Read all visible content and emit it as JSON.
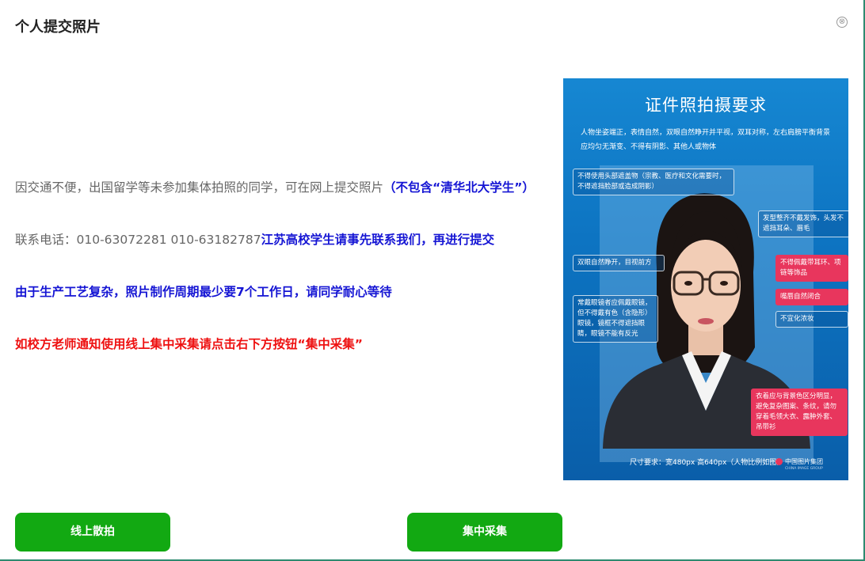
{
  "dialog": {
    "title": "个人提交照片",
    "close_symbol": "⊗"
  },
  "content": {
    "line1_gray": "因交通不便，出国留学等未参加集体拍照的同学，可在网上提交照片",
    "line1_blue": "（不包含“清华北大学生”）",
    "line2_gray": "联系电话：010-63072281 010-63182787",
    "line2_blue": "江苏高校学生请事先联系我们，再进行提交",
    "line3_blue": "由于生产工艺复杂，照片制作周期最少要7个工作日，请同学耐心等待",
    "line4_red": "如校方老师通知使用线上集中采集请点击右下方按钮“集中采集”"
  },
  "buttons": {
    "online_shoot": "线上散拍",
    "central_collect": "集中采集"
  },
  "poster": {
    "title": "证件照拍摄要求",
    "intro": "人物坐姿端正，表情自然，双眼自然睁开并平视，双耳对称，左右肩膀平衡背景应均匀无渐变、不得有阴影、其他人或物体",
    "tags": {
      "headwear": "不得使用头部遮盖物（宗教、医疗和文化需要时，不得遮挡脸部或造成阴影）",
      "hair": "发型整齐不戴发饰，头发不遮挡耳朵、眉毛",
      "eyes": "双眼自然睁开，目视前方",
      "earrings": "不得佩戴带耳环、项链等饰品",
      "lips": "嘴唇自然闭合",
      "makeup": "不宜化浓妆",
      "glasses": "常戴眼镜者应佩戴眼镜，但不得戴有色（含隐形）眼镜，镜框不得遮挡眼睛，眼镜不能有反光",
      "clothing": "衣着应与背景色区分明显，避免复杂图案、条纹，请勿穿着毛领大衣、露肿外套、吊带衫"
    },
    "size_requirement": "尺寸要求：宽480px 高640px（人物比例如图）",
    "logo_text": "中国图片集团",
    "logo_subtext": "CHINA IMAGE GROUP"
  },
  "colors": {
    "button_green": "#12a912",
    "highlight_blue": "#1515d4",
    "highlight_red": "#ee1111",
    "poster_blue": "#0d74c2",
    "tag_pink": "#e8365d"
  }
}
